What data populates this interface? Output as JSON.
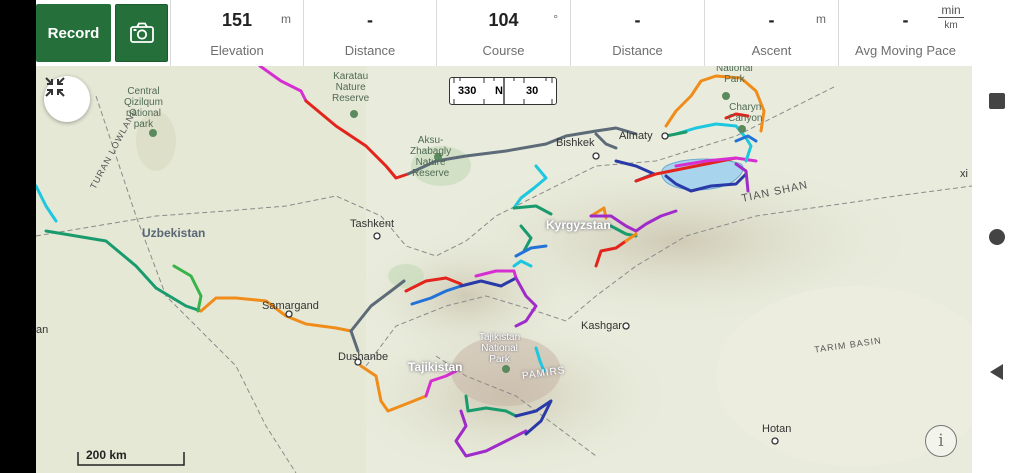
{
  "toolbar": {
    "record_label": "Record",
    "camera_icon": "camera-icon",
    "stats": [
      {
        "value": "151",
        "unit": "m",
        "label": "Elevation"
      },
      {
        "value": "-",
        "unit": "",
        "label": "Distance"
      },
      {
        "value": "104",
        "unit": "°",
        "label": "Course"
      },
      {
        "value": "-",
        "unit": "",
        "label": "Distance"
      },
      {
        "value": "-",
        "unit": "m",
        "label": "Ascent"
      },
      {
        "value": "-",
        "unit_num": "min",
        "unit_den": "km",
        "label": "Avg Moving Pace"
      }
    ]
  },
  "map": {
    "collapse_icon": "collapse-icon",
    "compass": {
      "left": "330",
      "center": "N",
      "right": "30"
    },
    "scale_label": "200 km",
    "info_icon": "info-icon",
    "info_glyph": "i",
    "labels": {
      "uzbekistan": "Uzbekistan",
      "kyrgyzstan": "Kyrgyzstan",
      "tajikistan": "Tajikistan",
      "tashkent": "Tashkent",
      "bishkek": "Bishkek",
      "almaty": "Almaty",
      "samargand": "Samargand",
      "dushanbe": "Dushanbe",
      "kashgar": "Kashgar",
      "hotan": "Hotan",
      "tian_shan": "TIAN SHAN",
      "pamirs": "PAMIRS",
      "tarim_basin": "TARIM BASIN",
      "turan_lowland": "TURAN LOWLAND",
      "central_qizilqum": "Central\nQizilqum\nnational\npark",
      "karatau": "Karatau\nNature\nReserve",
      "aksu": "Aksu-\nZhabagly\nNature\nReserve",
      "charyn": "Charyn\nCanyon",
      "national_park_top": "National\nPark",
      "tajikistan_np": "Tajikistan\nNational\nPark",
      "edge_left": "an",
      "edge_right": "xi"
    },
    "colors": {
      "green": "#25703a",
      "lake": "#a8d4ee",
      "background": "#e9ecdc"
    }
  },
  "navigation": {
    "recents_icon": "square-icon",
    "home_icon": "circle-icon",
    "back_icon": "back-triangle-icon"
  }
}
